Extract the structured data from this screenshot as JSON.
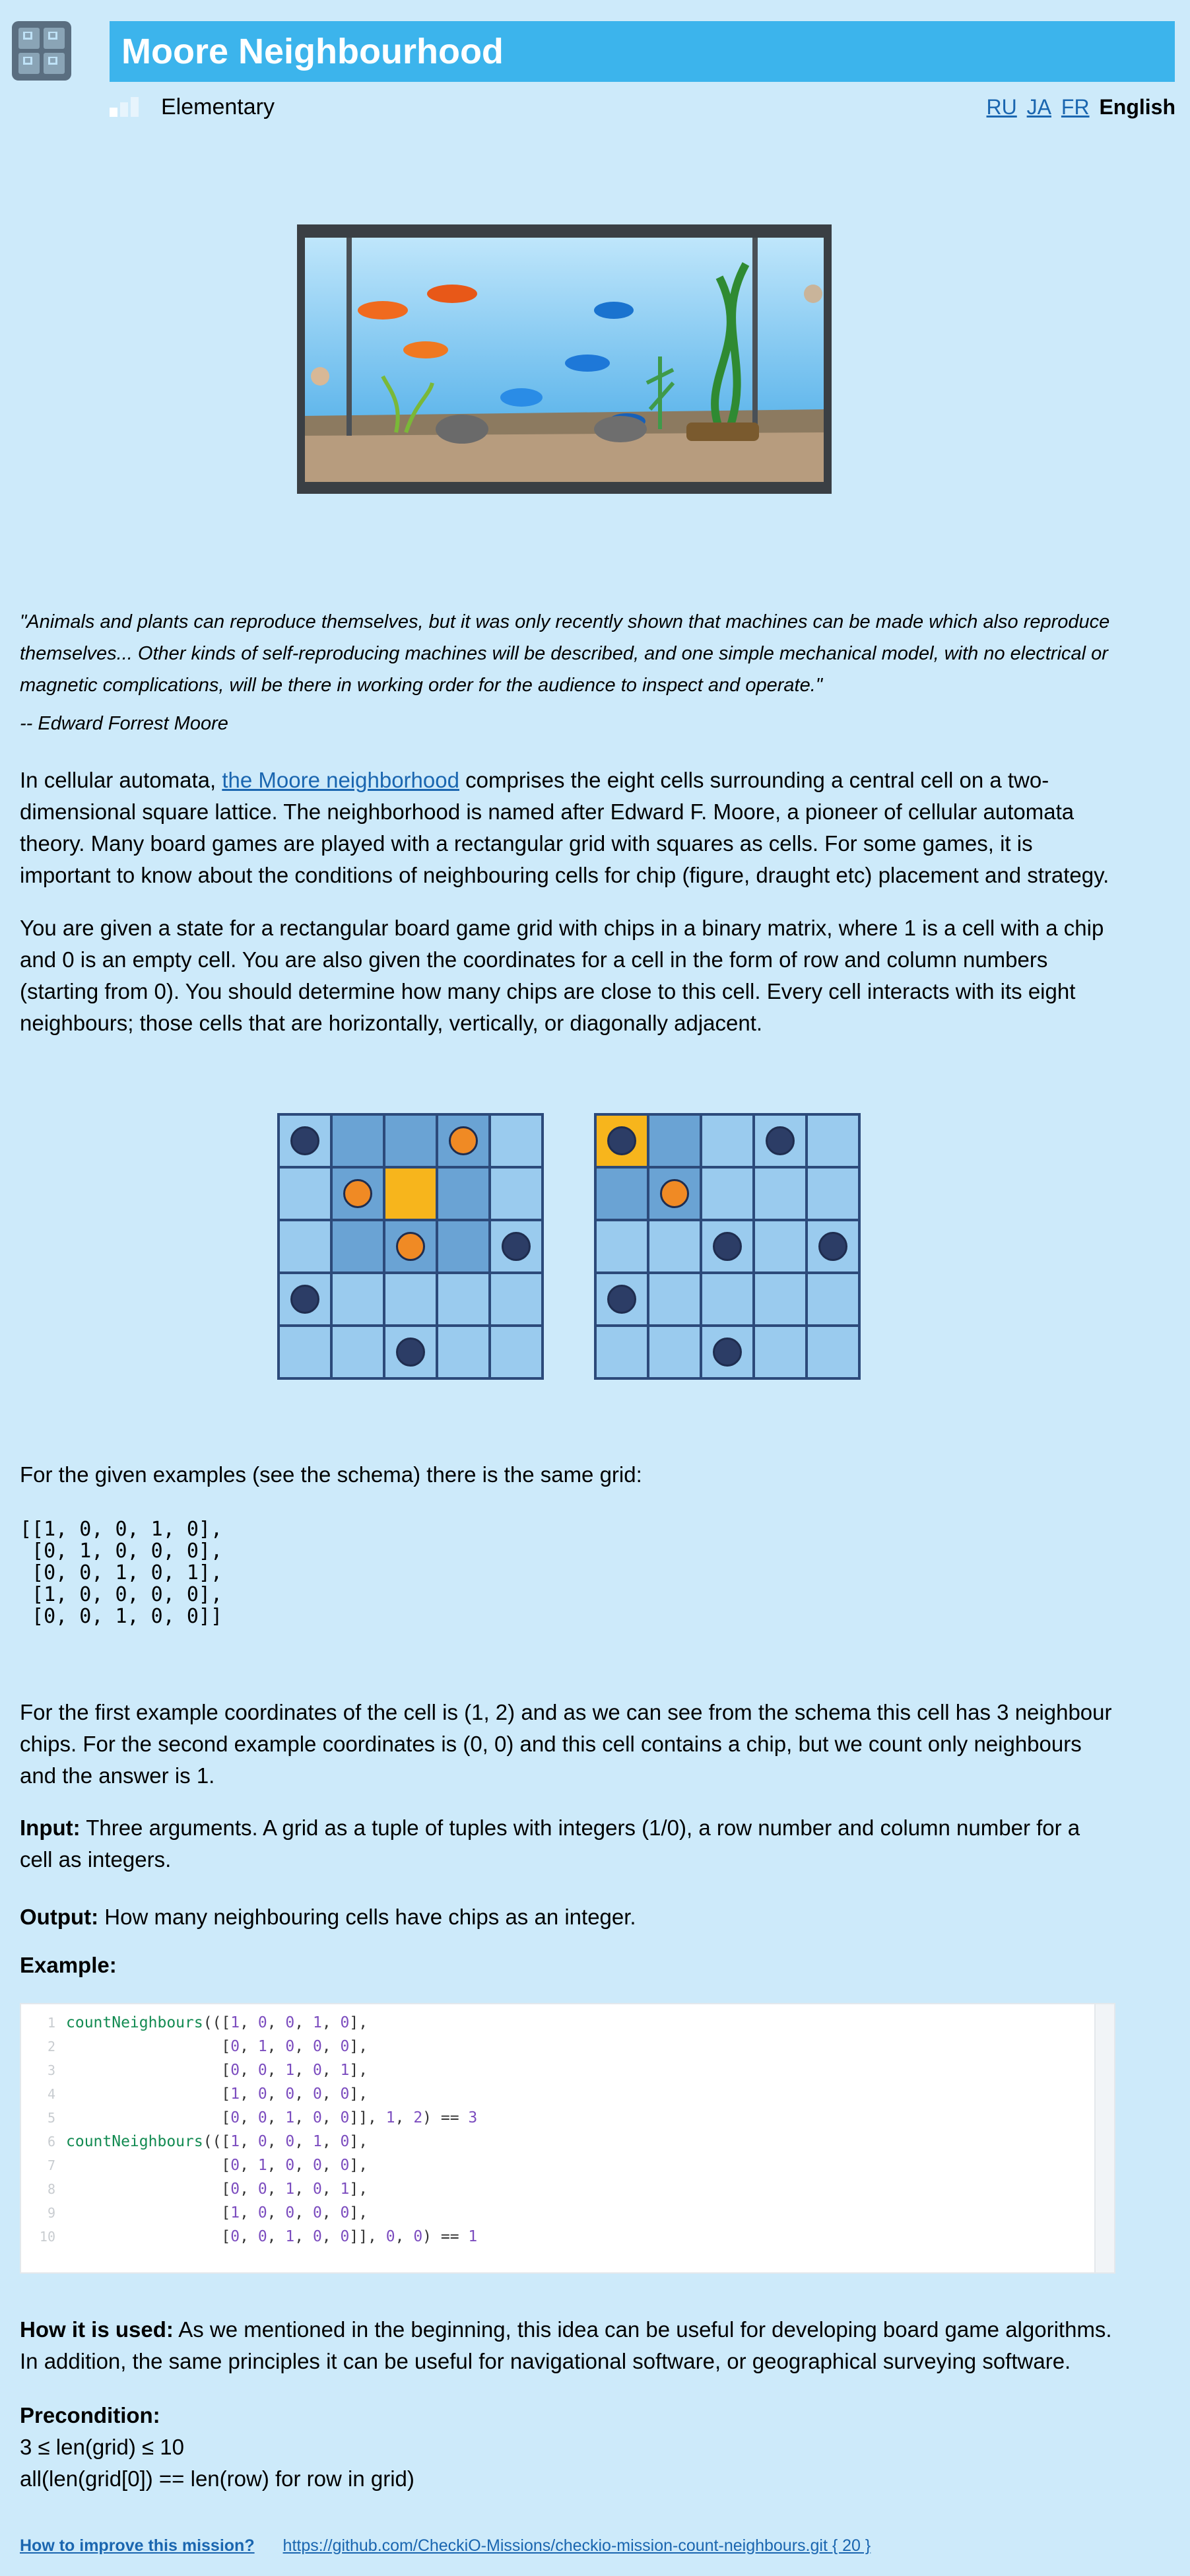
{
  "header": {
    "title": "Moore Neighbourhood",
    "level": "Elementary",
    "languages": [
      "RU",
      "JA",
      "FR"
    ],
    "current_language": "English"
  },
  "quote": {
    "text": "\"Animals and plants can reproduce themselves, but it was only recently shown that machines can be made which also reproduce themselves... Other kinds of self-reproducing machines will be described, and one simple mechanical model, with no electrical or magnetic complications, will be there in working order for the audience to inspect and operate.\"",
    "author": "-- Edward Forrest Moore"
  },
  "intro": {
    "before_link": "In cellular automata, ",
    "link_text": "the Moore neighborhood",
    "after_link": " comprises the eight cells surrounding a central cell on a two-dimensional square lattice. The neighborhood is named after Edward F. Moore, a pioneer of cellular automata theory. Many board games are played with a rectangular grid with squares as cells. For some games, it is important to know about the conditions of neighbouring cells for chip (figure, draught etc) placement and strategy."
  },
  "task": "You are given a state for a rectangular board game grid with chips in a binary matrix, where 1 is a cell with a chip and 0 is an empty cell. You are also given the coordinates for a cell in the form of row and column numbers (starting from 0). You should determine how many chips are close to this cell. Every cell interacts with its eight neighbours; those cells that are horizontally, vertically, or diagonally adjacent.",
  "schema": {
    "colors": {
      "light": "#9acbee",
      "neighbour": "#6aa3d4",
      "target": "#f7b51c",
      "chip_dark": "#2c3d66",
      "chip_orange": "#f08a24"
    },
    "grids": [
      {
        "target": [
          1,
          2
        ],
        "chips": [
          [
            0,
            0
          ],
          [
            0,
            3
          ],
          [
            1,
            1
          ],
          [
            2,
            2
          ],
          [
            2,
            4
          ],
          [
            3,
            0
          ],
          [
            4,
            2
          ]
        ],
        "counted": [
          [
            0,
            3
          ],
          [
            1,
            1
          ],
          [
            2,
            2
          ]
        ]
      },
      {
        "target": [
          0,
          0
        ],
        "chips": [
          [
            0,
            0
          ],
          [
            0,
            3
          ],
          [
            1,
            1
          ],
          [
            2,
            2
          ],
          [
            2,
            4
          ],
          [
            3,
            0
          ],
          [
            4,
            2
          ]
        ],
        "counted": [
          [
            1,
            1
          ]
        ]
      }
    ]
  },
  "same_grid_text": "For the given examples (see the schema) there is the same grid:",
  "grid_literal": "[[1, 0, 0, 1, 0],\n [0, 1, 0, 0, 0],\n [0, 0, 1, 0, 1],\n [1, 0, 0, 0, 0],\n [0, 0, 1, 0, 0]]",
  "explanation": "For the first example coordinates of the cell is (1, 2) and as we can see from the schema this cell has 3 neighbour chips. For the second example coordinates is (0, 0) and this cell contains a chip, but we count only neighbours and the answer is 1.",
  "input": {
    "label": "Input:",
    "text": " Three arguments. A grid as a tuple of tuples with integers (1/0), a row number and column number for a cell as integers."
  },
  "output": {
    "label": "Output:",
    "text": " How many neighbouring cells have chips as an integer."
  },
  "example_label": "Example:",
  "code_lines": [
    "countNeighbours(([1, 0, 0, 1, 0],",
    "                 [0, 1, 0, 0, 0],",
    "                 [0, 0, 1, 0, 1],",
    "                 [1, 0, 0, 0, 0],",
    "                 [0, 0, 1, 0, 0]], 1, 2) == 3",
    "countNeighbours(([1, 0, 0, 1, 0],",
    "                 [0, 1, 0, 0, 0],",
    "                 [0, 0, 1, 0, 1],",
    "                 [1, 0, 0, 0, 0],",
    "                 [0, 0, 1, 0, 0]], 0, 0) == 1"
  ],
  "how_used": {
    "label": "How it is used:",
    "text": " As we mentioned in the beginning, this idea can be useful for developing board game algorithms. In addition, the same principles it can be useful for navigational software, or geographical surveying software."
  },
  "precondition": {
    "label": "Precondition:",
    "line1": "3 ≤ len(grid) ≤ 10",
    "line2": "all(len(grid[0]) == len(row) for row in grid)"
  },
  "footer": {
    "improve": "How to improve this mission?",
    "repo": "https://github.com/CheckiO-Missions/checkio-mission-count-neighbours.git { 20 }"
  }
}
